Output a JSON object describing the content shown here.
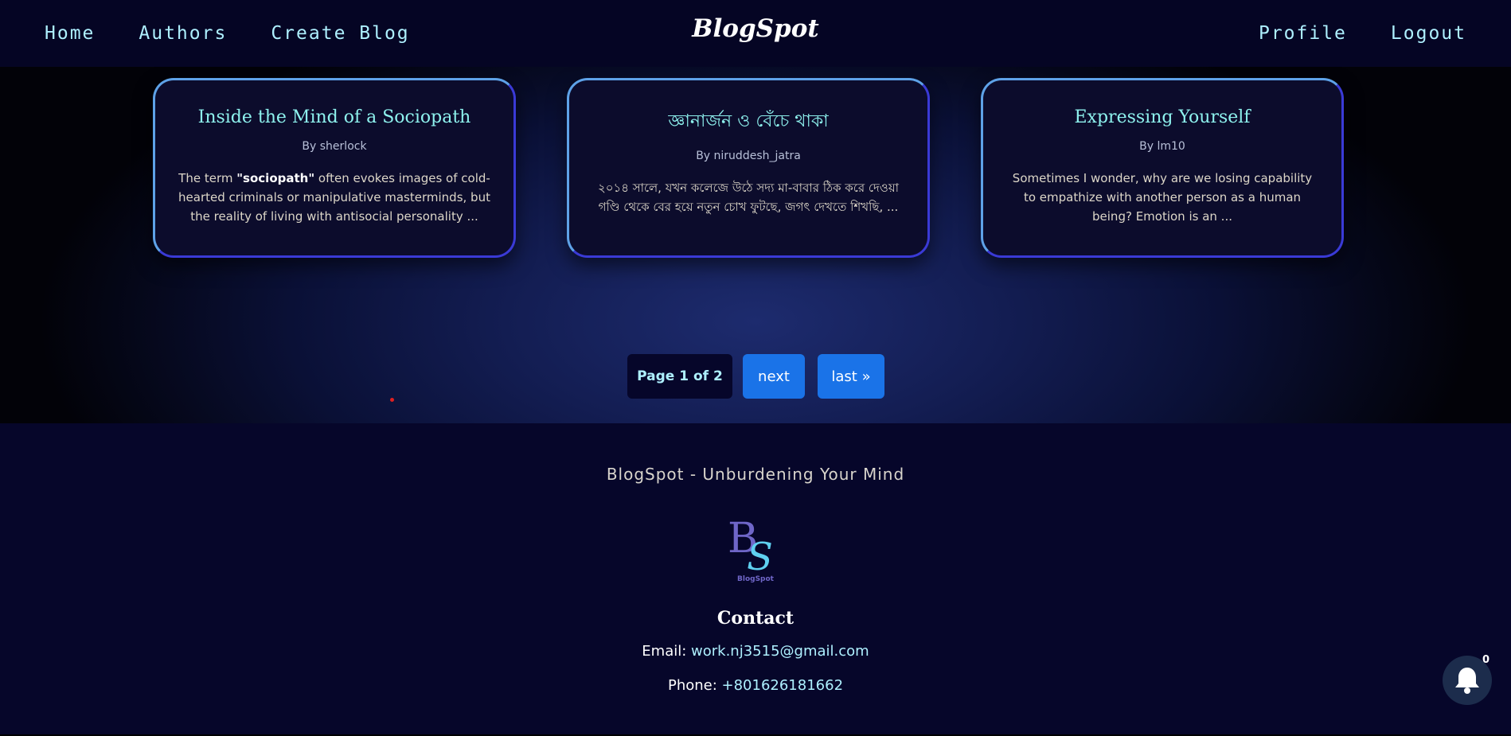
{
  "nav": {
    "left": [
      {
        "label": "Home"
      },
      {
        "label": "Authors"
      },
      {
        "label": "Create Blog"
      }
    ],
    "brand": "BlogSpot",
    "right": [
      {
        "label": "Profile"
      },
      {
        "label": "Logout"
      }
    ]
  },
  "cards": [
    {
      "title": "Inside the Mind of a Sociopath",
      "author": "By sherlock",
      "excerpt_pre": "The term ",
      "excerpt_bold": "\"sociopath\"",
      "excerpt_post": " often evokes images of cold-hearted criminals or manipulative masterminds, but the reality of living with antisocial personality ..."
    },
    {
      "title": "জ্ঞানার্জন ও বেঁচে থাকা",
      "author": "By niruddesh_jatra",
      "excerpt": "২০১৪ সালে, যখন কলেজে উঠে সদ্য মা-বাবার ঠিক করে দেওয়া গণ্ডি থেকে বের হয়ে নতুন চোখ ফুটছে, জগৎ দেখতে শিখছি, ..."
    },
    {
      "title": "Expressing Yourself",
      "author": "By lm10",
      "excerpt": "Sometimes I wonder, why are we losing capability to empathize with another person as a human being? Emotion is an ..."
    }
  ],
  "pagination": {
    "info": "Page 1 of 2",
    "next": "next",
    "last": "last »"
  },
  "footer": {
    "tagline": "BlogSpot - Unburdening Your Mind",
    "logo_text": "BlogSpot",
    "contact_heading": "Contact",
    "email_label": "Email: ",
    "email": "work.nj3515@gmail.com",
    "phone_label": "Phone: ",
    "phone": "+801626181662"
  },
  "notifications": {
    "count": "0",
    "icon": "bell-icon"
  },
  "colors": {
    "accent": "#aef0ff",
    "button": "#1a73e8",
    "background": "#06062a"
  }
}
